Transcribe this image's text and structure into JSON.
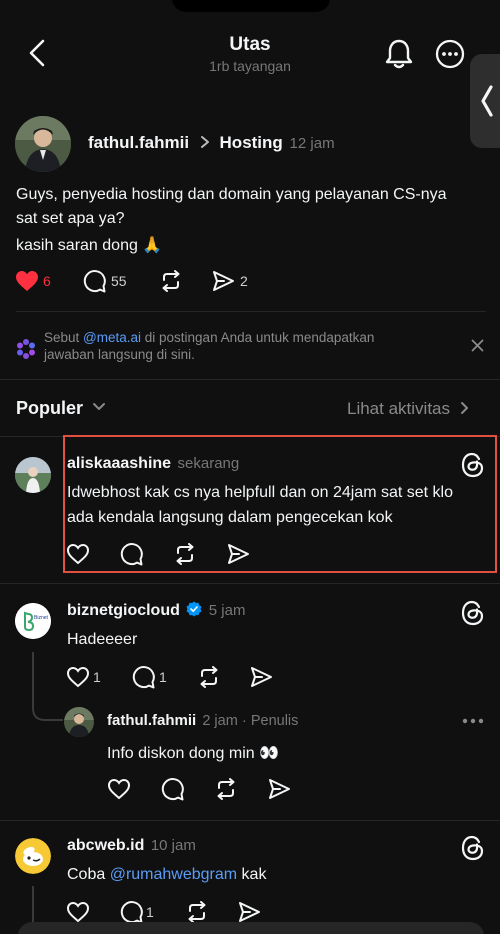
{
  "header": {
    "title": "Utas",
    "subtitle": "1rb tayangan"
  },
  "post": {
    "username": "fathul.fahmii",
    "topic": "Hosting",
    "time": "12 jam",
    "line1": "Guys, penyedia hosting dan domain yang pelayanan CS-nya",
    "line2": "sat set apa ya?",
    "line3": "kasih saran dong 🙏",
    "likes": "6",
    "comments": "55",
    "shares": "2"
  },
  "meta_ai": {
    "text_before": "Sebut ",
    "mention": "@meta.ai",
    "text_after": " di postingan Anda untuk mendapatkan",
    "line2": "jawaban langsung di sini."
  },
  "sort": {
    "label": "Populer",
    "activity": "Lihat aktivitas"
  },
  "replies": [
    {
      "username": "aliskaaashine",
      "time": "sekarang",
      "line1": "Idwebhost kak cs nya helpfull dan on 24jam sat set klo",
      "line2": "ada kendala langsung dalam pengecekan kok"
    },
    {
      "username": "biznetgiocloud",
      "time": "5 jam",
      "text": "Hadeeeer",
      "likes": "1",
      "comments": "1",
      "avatar_text": "Biznet"
    },
    {
      "username": "fathul.fahmii",
      "time": "2 jam",
      "tag": "· Penulis",
      "text": "Info diskon dong min 👀"
    },
    {
      "username": "abcweb.id",
      "time": "10 jam",
      "text_before": "Coba ",
      "mention": "@rumahwebgram",
      "text_after": " kak",
      "comments": "1"
    }
  ],
  "colors": {
    "background": "#101010",
    "like_red": "#ff3040",
    "link_blue": "#5b9cf6",
    "highlight": "#e0523f",
    "verified": "#0095f6"
  }
}
